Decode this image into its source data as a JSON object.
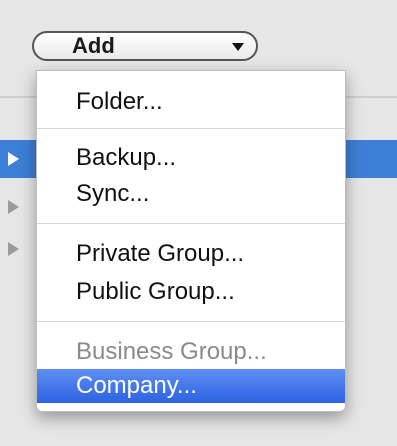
{
  "popup": {
    "label": "Add"
  },
  "menu": {
    "groups": [
      [
        {
          "label": "Folder...",
          "state": "normal"
        }
      ],
      [
        {
          "label": "Backup...",
          "state": "normal"
        },
        {
          "label": "Sync...",
          "state": "normal"
        }
      ],
      [
        {
          "label": "Private Group...",
          "state": "normal"
        },
        {
          "label": "Public Group...",
          "state": "normal"
        }
      ],
      [
        {
          "label": "Business Group...",
          "state": "disabled"
        },
        {
          "label": "Company...",
          "state": "highlighted"
        }
      ]
    ]
  },
  "colors": {
    "highlight": "#3a6fe8",
    "background_selection": "#3d7fd6",
    "disabled_text": "#8a8a8a"
  },
  "icons": [
    "chevron-down-icon",
    "disclosure-triangle-icon"
  ]
}
